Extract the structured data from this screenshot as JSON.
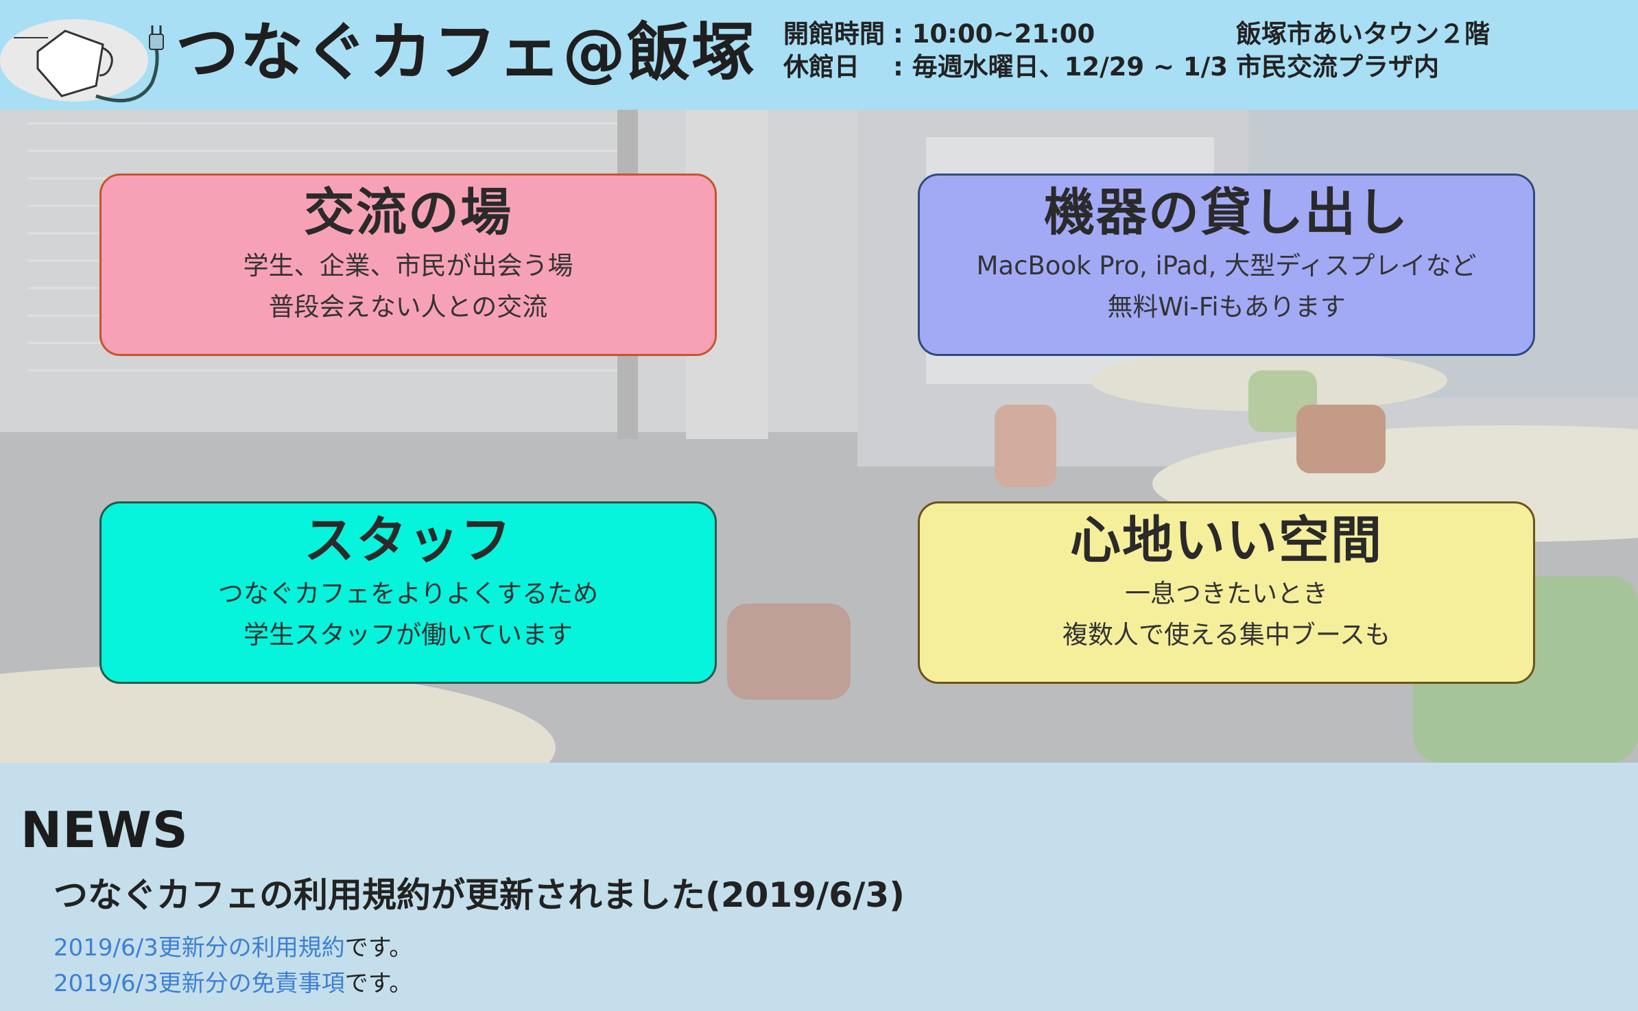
{
  "header": {
    "site_title": "つなぐカフェ@飯塚",
    "hours_label": "開館時間",
    "hours_value": ": 10:00~21:00",
    "closed_label": "休館日",
    "closed_value": ": 毎週水曜日、12/29 ~ 1/3",
    "address_line1": "飯塚市あいタウン２階",
    "address_line2": "市民交流プラザ内"
  },
  "features": [
    {
      "title": "交流の場",
      "line1": "学生、企業、市民が出会う場",
      "line2": "普段会えない人との交流",
      "color": "#f7a1b6"
    },
    {
      "title": "機器の貸し出し",
      "line1": "MacBook Pro, iPad, 大型ディスプレイなど",
      "line2": "無料Wi-Fiもあります",
      "color": "#a2aaf6"
    },
    {
      "title": "スタッフ",
      "line1": "つなぐカフェをよりよくするため",
      "line2": "学生スタッフが働いています",
      "color": "#06f3dc"
    },
    {
      "title": "心地いい空間",
      "line1": "一息つきたいとき",
      "line2": "複数人で使える集中ブースも",
      "color": "#f5ef9c"
    }
  ],
  "news": {
    "heading": "NEWS",
    "item_title": "つなぐカフェの利用規約が更新されました(2019/6/3)",
    "link1_text": "2019/6/3更新分の利用規約",
    "link1_suffix": "です。",
    "link2_text": "2019/6/3更新分の免責事項",
    "link2_suffix": "です。",
    "link_color": "#3d7fd6"
  },
  "icons": {
    "logo": "coffee-cup-plug-logo"
  }
}
